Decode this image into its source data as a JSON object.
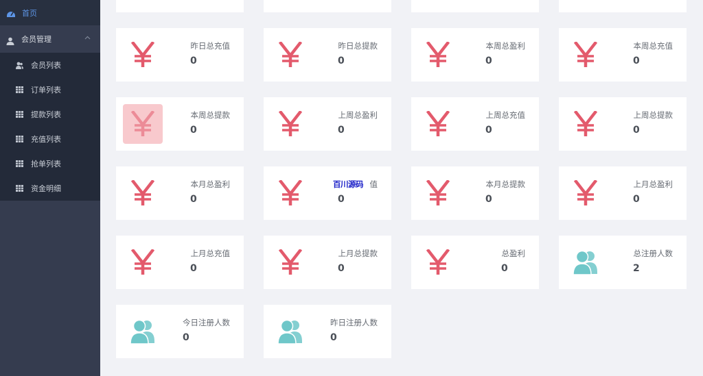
{
  "sidebar": {
    "home_label": "首页",
    "group_label": "会员管理",
    "items": [
      {
        "label": "会员列表",
        "icon": "users-icon"
      },
      {
        "label": "订单列表",
        "icon": "grid-icon"
      },
      {
        "label": "提款列表",
        "icon": "grid-icon"
      },
      {
        "label": "充值列表",
        "icon": "grid-icon"
      },
      {
        "label": "抢单列表",
        "icon": "grid-icon"
      },
      {
        "label": "资金明细",
        "icon": "grid-icon"
      }
    ],
    "accent_color": "#5d95e6"
  },
  "stats": [
    {
      "label": "昨日总充值",
      "value": "0",
      "icon": "yen-icon"
    },
    {
      "label": "昨日总提款",
      "value": "0",
      "icon": "yen-icon"
    },
    {
      "label": "本周总盈利",
      "value": "0",
      "icon": "yen-icon"
    },
    {
      "label": "本周总充值",
      "value": "0",
      "icon": "yen-icon"
    },
    {
      "label": "本周总提款",
      "value": "0",
      "icon": "yen-icon"
    },
    {
      "label": "上周总盈利",
      "value": "0",
      "icon": "yen-icon"
    },
    {
      "label": "上周总充值",
      "value": "0",
      "icon": "yen-icon"
    },
    {
      "label": "上周总提款",
      "value": "0",
      "icon": "yen-icon"
    },
    {
      "label": "本月总盈利",
      "value": "0",
      "icon": "yen-icon"
    },
    {
      "label": "值",
      "value": "0",
      "icon": "yen-icon",
      "watermark": "百川源码"
    },
    {
      "label": "本月总提款",
      "value": "0",
      "icon": "yen-icon"
    },
    {
      "label": "上月总盈利",
      "value": "0",
      "icon": "yen-icon"
    },
    {
      "label": "上月总充值",
      "value": "0",
      "icon": "yen-icon"
    },
    {
      "label": "上月总提款",
      "value": "0",
      "icon": "yen-icon"
    },
    {
      "label": "总盈利",
      "value": "0",
      "icon": "yen-icon"
    },
    {
      "label": "总注册人数",
      "value": "2",
      "icon": "users-icon"
    },
    {
      "label": "今日注册人数",
      "value": "0",
      "icon": "users-icon"
    },
    {
      "label": "昨日注册人数",
      "value": "0",
      "icon": "users-icon"
    }
  ],
  "colors": {
    "yen": "#e35a6c",
    "users": "#6fc7c9",
    "highlight_bg": "#f8c9cd"
  }
}
